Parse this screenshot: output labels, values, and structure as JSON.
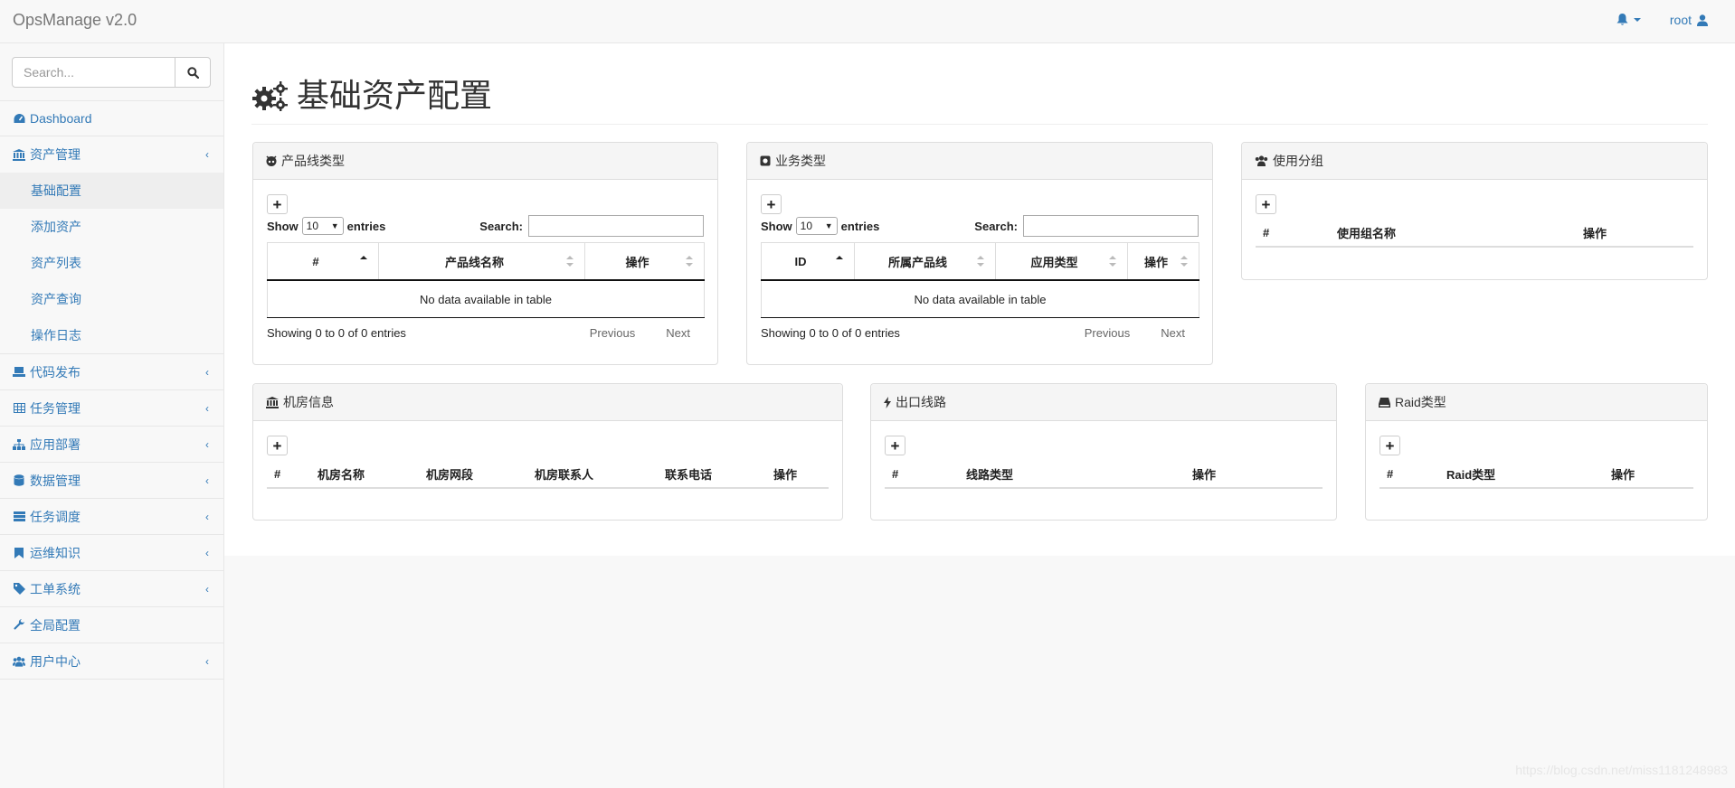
{
  "navbar": {
    "brand": "OpsManage v2.0",
    "user": "root"
  },
  "sidebar": {
    "search_placeholder": "Search...",
    "dashboard": "Dashboard",
    "asset": {
      "label": "资产管理",
      "sub": [
        "基础配置",
        "添加资产",
        "资产列表",
        "资产查询",
        "操作日志"
      ]
    },
    "items": [
      "代码发布",
      "任务管理",
      "应用部署",
      "数据管理",
      "任务调度",
      "运维知识",
      "工单系统",
      "全局配置",
      "用户中心"
    ]
  },
  "page": {
    "title": "基础资产配置"
  },
  "datatable": {
    "show": "Show",
    "entries": "entries",
    "length_value": "10",
    "search": "Search:",
    "empty": "No data available in table",
    "info": "Showing 0 to 0 of 0 entries",
    "previous": "Previous",
    "next": "Next"
  },
  "panels": {
    "product_line": {
      "title": "产品线类型",
      "columns": [
        "#",
        "产品线名称",
        "操作"
      ]
    },
    "business": {
      "title": "业务类型",
      "columns": [
        "ID",
        "所属产品线",
        "应用类型",
        "操作"
      ]
    },
    "group": {
      "title": "使用分组",
      "columns": [
        "#",
        "使用组名称",
        "操作"
      ]
    },
    "idc": {
      "title": "机房信息",
      "columns": [
        "#",
        "机房名称",
        "机房网段",
        "机房联系人",
        "联系电话",
        "操作"
      ]
    },
    "line": {
      "title": "出口线路",
      "columns": [
        "#",
        "线路类型",
        "操作"
      ]
    },
    "raid": {
      "title": "Raid类型",
      "columns": [
        "#",
        "Raid类型",
        "操作"
      ]
    }
  },
  "watermark": "https://blog.csdn.net/miss1181248983",
  "colors": {
    "link": "#337ab7",
    "sidebar_bg": "#f8f8f8",
    "border": "#e7e7e7"
  }
}
